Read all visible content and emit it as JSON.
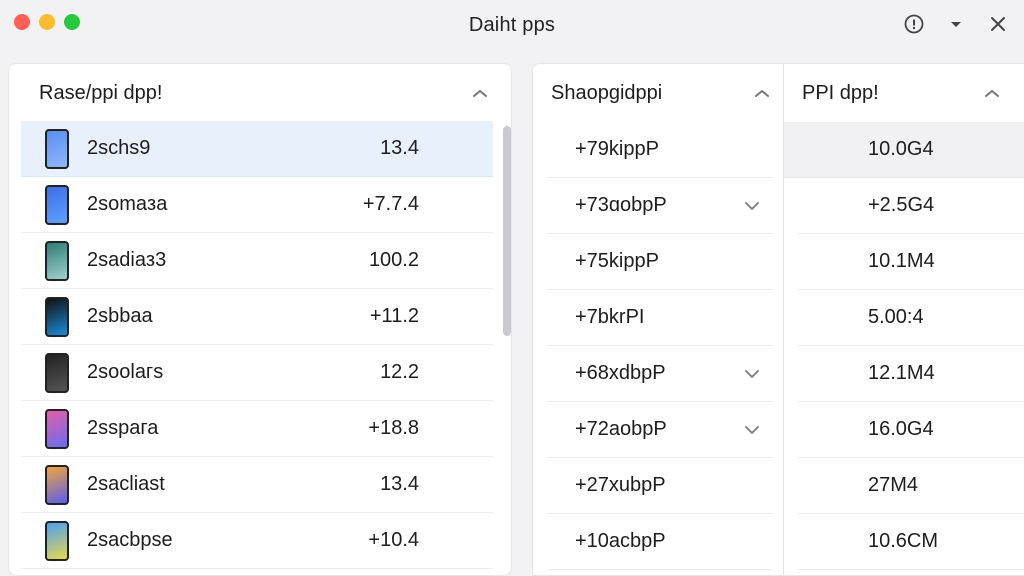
{
  "window": {
    "title": "Daiht pps"
  },
  "left_panel": {
    "header": "Rase/ppi dpp!",
    "rows": [
      {
        "name": "2schs9",
        "value": "13.4",
        "icon": "phone-icon",
        "colors": [
          "#5b8ef0",
          "#8fb6ff"
        ],
        "selected": true
      },
      {
        "name": "2somaза",
        "value": "+7.7.4",
        "icon": "phone-icon",
        "colors": [
          "#3e6ee6",
          "#5da0ff"
        ],
        "selected": false
      },
      {
        "name": "2sadiaз3",
        "value": "100.2",
        "icon": "phone-icon",
        "colors": [
          "#2f7c74",
          "#9fd3cf"
        ],
        "selected": false
      },
      {
        "name": "2sbbaa",
        "value": "+11.2",
        "icon": "phone-icon",
        "colors": [
          "#111",
          "#1d8bd8"
        ],
        "selected": false
      },
      {
        "name": "2soolaгs",
        "value": "12.2",
        "icon": "phone-icon",
        "colors": [
          "#222",
          "#555"
        ],
        "selected": false
      },
      {
        "name": "2sspaга",
        "value": "+18.8",
        "icon": "phone-icon",
        "colors": [
          "#e25fa9",
          "#6a6cf0"
        ],
        "selected": false
      },
      {
        "name": "2sacliast",
        "value": "13.4",
        "icon": "phone-icon",
        "colors": [
          "#f0a33c",
          "#5c5ef0"
        ],
        "selected": false
      },
      {
        "name": "2sacbpse",
        "value": "+10.4",
        "icon": "phone-icon",
        "colors": [
          "#4aa0f0",
          "#e8d84e"
        ],
        "selected": false
      }
    ]
  },
  "mid_column": {
    "header": "Shaopgidppi",
    "rows": [
      {
        "text": "+79kippP",
        "check": false
      },
      {
        "text": "+73ɑobpP",
        "check": true
      },
      {
        "text": "+75kippP",
        "check": false
      },
      {
        "text": "+7bkrPI",
        "check": false
      },
      {
        "text": "+68xdbpP",
        "check": true
      },
      {
        "text": "+72aobpP",
        "check": true
      },
      {
        "text": "+27xubpP",
        "check": false
      },
      {
        "text": "+10acbpP",
        "check": false
      }
    ]
  },
  "right_column": {
    "header": "PPI dpp!",
    "rows": [
      {
        "text": "10.0G4",
        "shaded": true
      },
      {
        "text": "+2.5G4",
        "shaded": false
      },
      {
        "text": "10.1M4",
        "shaded": false
      },
      {
        "text": "5.00:4",
        "shaded": false
      },
      {
        "text": "12.1M4",
        "shaded": false
      },
      {
        "text": "16.0G4",
        "shaded": false
      },
      {
        "text": "27M4",
        "shaded": false
      },
      {
        "text": "10.6CM",
        "shaded": false
      }
    ]
  },
  "colors": {
    "selection": "#e8f0fb",
    "accent": "#5b8ef0"
  }
}
